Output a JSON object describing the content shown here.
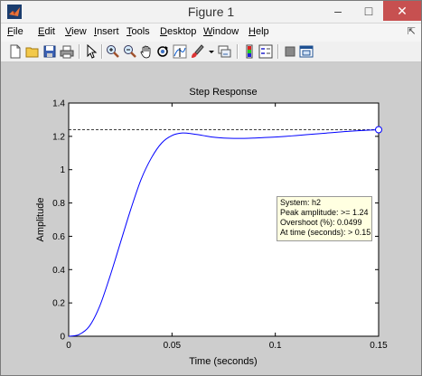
{
  "window": {
    "title": "Figure 1"
  },
  "menu": [
    {
      "pre": "",
      "mn": "F",
      "post": "ile"
    },
    {
      "pre": "",
      "mn": "E",
      "post": "dit"
    },
    {
      "pre": "",
      "mn": "V",
      "post": "iew"
    },
    {
      "pre": "",
      "mn": "I",
      "post": "nsert"
    },
    {
      "pre": "",
      "mn": "T",
      "post": "ools"
    },
    {
      "pre": "",
      "mn": "D",
      "post": "esktop"
    },
    {
      "pre": "",
      "mn": "W",
      "post": "indow"
    },
    {
      "pre": "",
      "mn": "H",
      "post": "elp"
    }
  ],
  "toolbar_icons": [
    "new-figure-icon",
    "open-file-icon",
    "save-icon",
    "print-icon",
    "edit-plot-arrow-icon",
    "zoom-in-icon",
    "zoom-out-icon",
    "pan-hand-icon",
    "rotate-3d-icon",
    "data-cursor-icon",
    "brush-icon",
    "link-plot-icon",
    "insert-colorbar-icon",
    "insert-legend-icon",
    "hide-plot-tools-icon",
    "show-plot-tools-icon"
  ],
  "chart_data": {
    "type": "line",
    "title": "Step Response",
    "xlabel": "Time (seconds)",
    "ylabel": "Amplitude",
    "xlim": [
      0,
      0.15
    ],
    "ylim": [
      0,
      1.4
    ],
    "xticks": [
      "0",
      "0.05",
      "0.1",
      "0.15"
    ],
    "yticks": [
      "0",
      "0.2",
      "0.4",
      "0.6",
      "0.8",
      "1",
      "1.2",
      "1.4"
    ],
    "series": [
      {
        "color": "#0000ff",
        "x": [
          0,
          0.005,
          0.01,
          0.015,
          0.02,
          0.025,
          0.03,
          0.035,
          0.04,
          0.045,
          0.05,
          0.055,
          0.06,
          0.065,
          0.07,
          0.075,
          0.08,
          0.085,
          0.09,
          0.095,
          0.1,
          0.105,
          0.11,
          0.115,
          0.12,
          0.125,
          0.13,
          0.135,
          0.14,
          0.145,
          0.15
        ],
        "y": [
          0,
          0.01,
          0.06,
          0.18,
          0.36,
          0.56,
          0.76,
          0.94,
          1.07,
          1.16,
          1.205,
          1.22,
          1.215,
          1.205,
          1.195,
          1.19,
          1.188,
          1.188,
          1.19,
          1.193,
          1.196,
          1.2,
          1.205,
          1.21,
          1.215,
          1.22,
          1.225,
          1.23,
          1.234,
          1.237,
          1.24
        ]
      }
    ],
    "reference_line_y": 1.24,
    "marker": {
      "x": 0.15,
      "y": 1.24
    }
  },
  "datatip": {
    "line1": "System: h2",
    "line2": "Peak amplitude: >= 1.24",
    "line3": "Overshoot (%): 0.0499",
    "line4": "At time (seconds): > 0.15"
  }
}
